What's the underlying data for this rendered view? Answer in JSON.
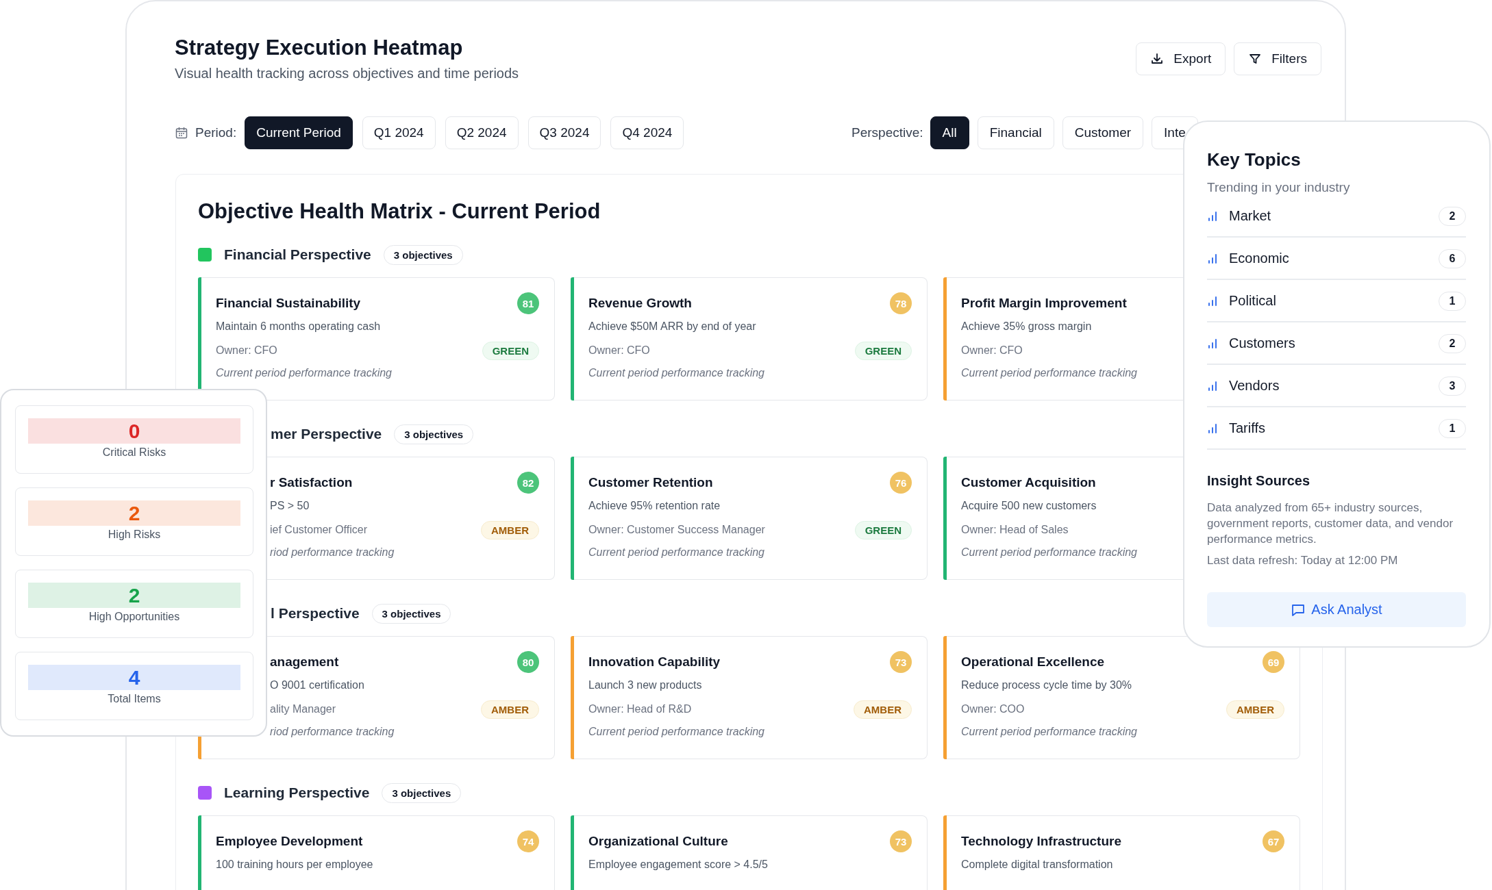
{
  "header": {
    "title": "Strategy Execution Heatmap",
    "subtitle": "Visual health tracking across objectives and time periods",
    "actions": [
      {
        "label": "Export",
        "kind": "export"
      },
      {
        "label": "Filters",
        "kind": "filter"
      }
    ]
  },
  "period": {
    "label": "Period:",
    "options": [
      {
        "label": "Current Period",
        "selected": true
      },
      {
        "label": "Q1 2024",
        "selected": false
      },
      {
        "label": "Q2 2024",
        "selected": false
      },
      {
        "label": "Q3 2024",
        "selected": false
      },
      {
        "label": "Q4 2024",
        "selected": false
      }
    ]
  },
  "perspective": {
    "label": "Perspective:",
    "options": [
      {
        "label": "All",
        "selected": true
      },
      {
        "label": "Financial",
        "selected": false
      },
      {
        "label": "Customer",
        "selected": false
      },
      {
        "label": "Inte",
        "selected": false
      }
    ]
  },
  "matrix": {
    "title": "Objective Health Matrix - Current Period",
    "sections": [
      {
        "kind": "full",
        "title": "Financial Perspective",
        "color": "#22c55e",
        "count": "3 objectives",
        "cards": [
          {
            "kind": "full",
            "color": "#22b573",
            "title": "Financial Sustainability",
            "score": {
              "value": "81",
              "color": "#4cc47a"
            },
            "description": "Maintain 6 months operating cash",
            "owner": "Owner: CFO",
            "status": {
              "label": "GREEN",
              "kind": "green"
            },
            "note": "Current period performance tracking"
          },
          {
            "kind": "full",
            "color": "#22b573",
            "title": "Revenue Growth",
            "score": {
              "value": "78",
              "color": "#f0c262"
            },
            "description": "Achieve $50M ARR by end of year",
            "owner": "Owner: CFO",
            "status": {
              "label": "GREEN",
              "kind": "green"
            },
            "note": "Current period performance tracking"
          },
          {
            "kind": "full",
            "color": "#f5a033",
            "title": "Profit Margin Improvement",
            "description": "Achieve 35% gross margin",
            "owner": "Owner: CFO",
            "note": "Current period performance tracking"
          }
        ]
      },
      {
        "kind": "clipped",
        "title": "mer Perspective",
        "count": "3 objectives",
        "cards": [
          {
            "kind": "clipped",
            "title": "r Satisfaction",
            "score": {
              "value": "82",
              "color": "#4cc47a"
            },
            "description": "PS > 50",
            "owner": "ief Customer Officer",
            "status": {
              "label": "AMBER",
              "kind": "amber"
            },
            "note": "riod performance tracking"
          },
          {
            "kind": "full",
            "color": "#22b573",
            "title": "Customer Retention",
            "score": {
              "value": "76",
              "color": "#f0c262"
            },
            "description": "Achieve 95% retention rate",
            "owner": "Owner: Customer Success Manager",
            "status": {
              "label": "GREEN",
              "kind": "green"
            },
            "note": "Current period performance tracking"
          },
          {
            "kind": "full",
            "color": "#22b573",
            "title": "Customer Acquisition",
            "description": "Acquire 500 new customers",
            "owner": "Owner: Head of Sales",
            "note": "Current period performance tracking"
          }
        ]
      },
      {
        "kind": "clipped",
        "title": "l Perspective",
        "count": "3 objectives",
        "cards": [
          {
            "kind": "clipped",
            "color": "#f5a033",
            "title": "anagement",
            "score": {
              "value": "80",
              "color": "#4cc47a"
            },
            "description": "O 9001 certification",
            "owner": "ality Manager",
            "status": {
              "label": "AMBER",
              "kind": "amber"
            },
            "note": "riod performance tracking"
          },
          {
            "kind": "full",
            "color": "#f5a033",
            "title": "Innovation Capability",
            "score": {
              "value": "73",
              "color": "#f0c262"
            },
            "description": "Launch 3 new products",
            "owner": "Owner: Head of R&D",
            "status": {
              "label": "AMBER",
              "kind": "amber"
            },
            "note": "Current period performance tracking"
          },
          {
            "kind": "full",
            "color": "#f5a033",
            "title": "Operational Excellence",
            "score": {
              "value": "69",
              "color": "#f0c262"
            },
            "description": "Reduce process cycle time by 30%",
            "owner": "Owner: COO",
            "status": {
              "label": "AMBER",
              "kind": "amber"
            },
            "note": "Current period performance tracking"
          }
        ]
      },
      {
        "kind": "full",
        "title": "Learning Perspective",
        "color": "#a855f7",
        "count": "3 objectives",
        "cards": [
          {
            "kind": "full",
            "color": "#22b573",
            "title": "Employee Development",
            "score": {
              "value": "74",
              "color": "#f0c262"
            },
            "description": "100 training hours per employee"
          },
          {
            "kind": "full",
            "color": "#22b573",
            "title": "Organizational Culture",
            "score": {
              "value": "73",
              "color": "#f0c262"
            },
            "description": "Employee engagement score > 4.5/5"
          },
          {
            "kind": "full",
            "color": "#f5a033",
            "title": "Technology Infrastructure",
            "score": {
              "value": "67",
              "color": "#f0c262"
            },
            "description": "Complete digital transformation"
          }
        ]
      }
    ]
  },
  "stats": [
    {
      "value": "0",
      "label": "Critical Risks",
      "color": "#dc2626"
    },
    {
      "value": "2",
      "label": "High Risks",
      "color": "#ea580c"
    },
    {
      "value": "2",
      "label": "High Opportunities",
      "color": "#16a34a"
    },
    {
      "value": "4",
      "label": "Total Items",
      "color": "#2563eb"
    }
  ],
  "key_topics": {
    "title": "Key Topics",
    "subtitle": "Trending in your industry",
    "topics": [
      {
        "label": "Market",
        "count": "2"
      },
      {
        "label": "Economic",
        "count": "6"
      },
      {
        "label": "Political",
        "count": "1"
      },
      {
        "label": "Customers",
        "count": "2"
      },
      {
        "label": "Vendors",
        "count": "3"
      },
      {
        "label": "Tariffs",
        "count": "1"
      }
    ],
    "sources_title": "Insight Sources",
    "sources_text": "Data analyzed from 65+ industry sources, government reports, customer data, and vendor performance metrics.",
    "refresh": "Last data refresh: Today at 12:00 PM",
    "button": "Ask Analyst"
  }
}
